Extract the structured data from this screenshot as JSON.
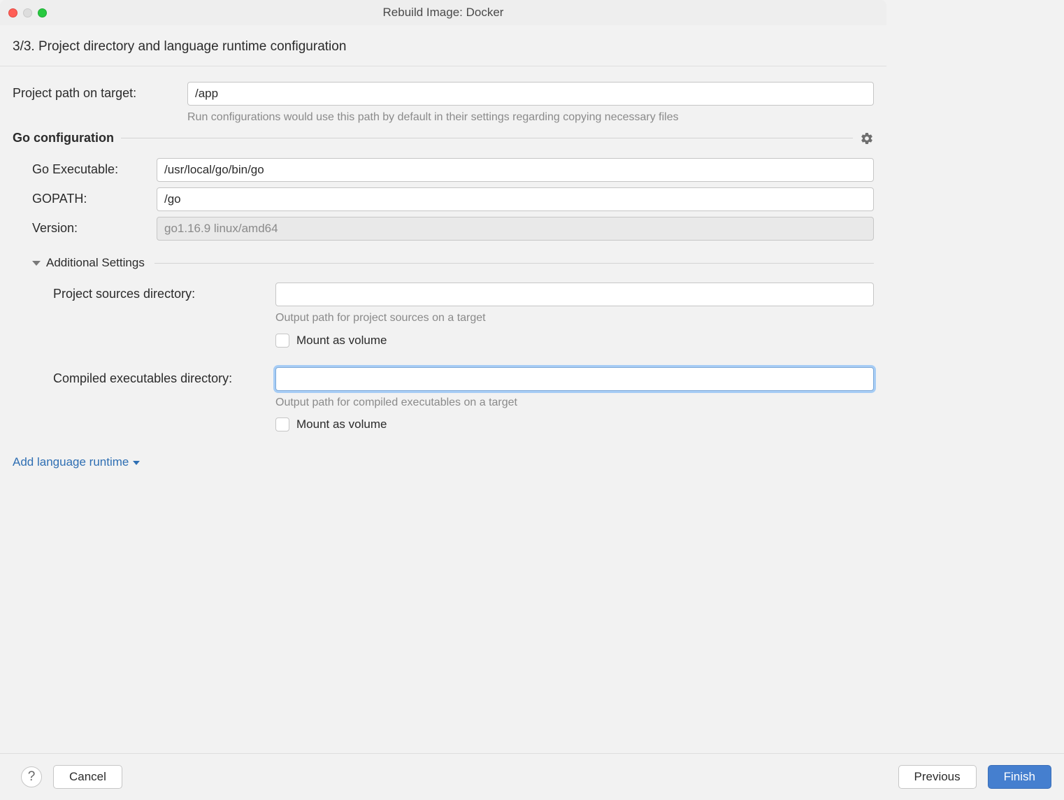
{
  "window": {
    "title": "Rebuild Image: Docker"
  },
  "step": {
    "heading": "3/3. Project directory and language runtime configuration"
  },
  "projectPath": {
    "label": "Project path on target:",
    "value": "/app",
    "hint": "Run configurations would use this path by default in their settings regarding copying necessary files"
  },
  "goConfig": {
    "section": "Go configuration",
    "executable": {
      "label": "Go Executable:",
      "value": "/usr/local/go/bin/go"
    },
    "gopath": {
      "label": "GOPATH:",
      "value": "/go"
    },
    "version": {
      "label": "Version:",
      "value": "go1.16.9 linux/amd64"
    }
  },
  "additional": {
    "title": "Additional Settings",
    "sources": {
      "label": "Project sources directory:",
      "value": "",
      "hint": "Output path for project sources on a target",
      "mountLabel": "Mount as volume"
    },
    "compiled": {
      "label": "Compiled executables directory:",
      "value": "",
      "hint": "Output path for compiled executables on a target",
      "mountLabel": "Mount as volume"
    }
  },
  "addRuntime": "Add language runtime",
  "buttons": {
    "help": "?",
    "cancel": "Cancel",
    "previous": "Previous",
    "finish": "Finish"
  }
}
